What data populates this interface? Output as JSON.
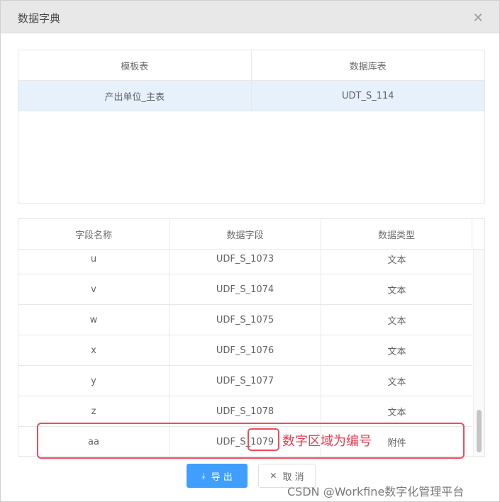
{
  "dialog": {
    "title": "数据字典",
    "close_icon": "close-icon"
  },
  "template_table": {
    "headers": [
      "模板表",
      "数据库表"
    ],
    "rows": [
      [
        "产出单位_主表",
        "UDT_S_114"
      ]
    ]
  },
  "field_table": {
    "headers": [
      "字段名称",
      "数据字段",
      "数据类型"
    ],
    "rows": [
      [
        "u",
        "UDF_S_1073",
        "文本"
      ],
      [
        "v",
        "UDF_S_1074",
        "文本"
      ],
      [
        "w",
        "UDF_S_1075",
        "文本"
      ],
      [
        "x",
        "UDF_S_1076",
        "文本"
      ],
      [
        "y",
        "UDF_S_1077",
        "文本"
      ],
      [
        "z",
        "UDF_S_1078",
        "文本"
      ],
      [
        "aa",
        "UDF_S_1079",
        "附件"
      ]
    ]
  },
  "annotation": {
    "text": "数字区域为编号",
    "color": "#ee3b4e"
  },
  "buttons": {
    "export_label": "导 出",
    "export_icon": "download-icon",
    "cancel_label": "取 消",
    "cancel_icon": "close-icon"
  },
  "colors": {
    "primary": "#409eff",
    "selected_row": "#e7f1fc",
    "annotation_red": "#ee4b5e"
  },
  "watermark": "CSDN @Workfine数字化管理平台"
}
